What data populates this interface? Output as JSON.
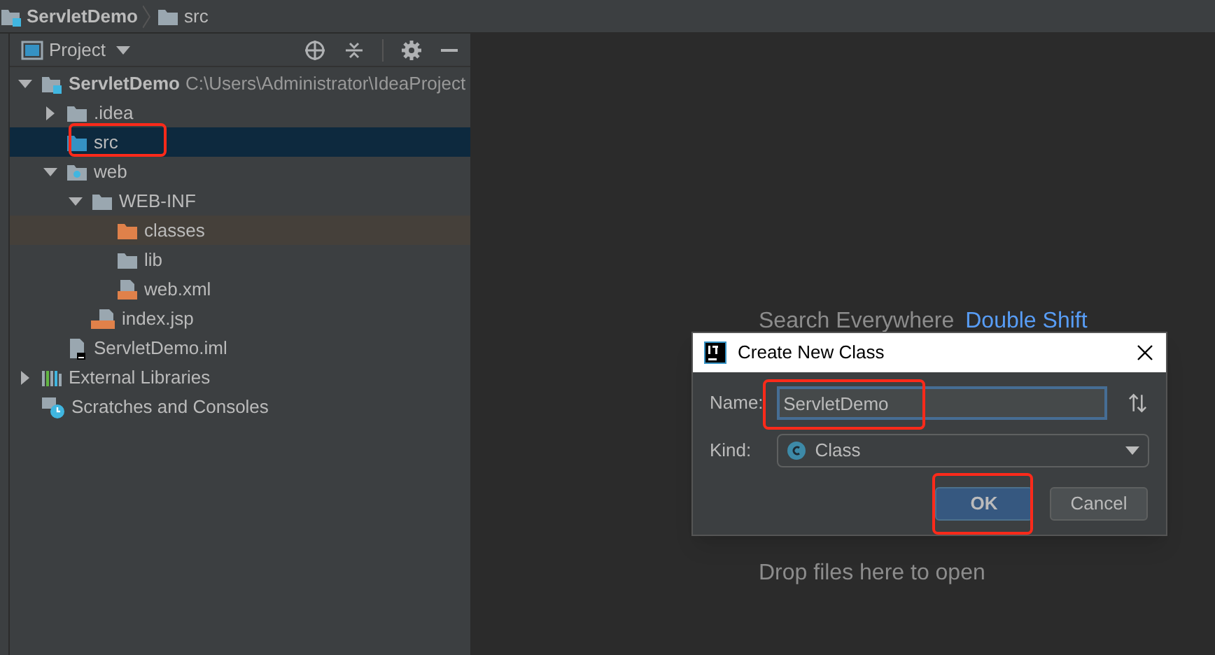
{
  "breadcrumbs": [
    {
      "label": "ServletDemo",
      "kind": "module"
    },
    {
      "label": "src",
      "kind": "folder"
    }
  ],
  "project_panel": {
    "title": "Project",
    "tree": [
      {
        "label": "ServletDemo",
        "hint": "C:\\Users\\Administrator\\IdeaProject",
        "kind": "module",
        "expanded": true,
        "selected": false,
        "highlighted": false,
        "children": [
          {
            "label": ".idea",
            "kind": "folder",
            "expanded": false,
            "selected": false,
            "highlighted": false
          },
          {
            "label": "src",
            "kind": "source",
            "selected": true,
            "highlighted": true
          },
          {
            "label": "web",
            "kind": "web",
            "expanded": true,
            "selected": false,
            "highlighted": false,
            "children": [
              {
                "label": "WEB-INF",
                "kind": "folder",
                "expanded": true,
                "selected": false,
                "highlighted": false,
                "children": [
                  {
                    "label": "classes",
                    "kind": "excluded",
                    "selected": false,
                    "hovered": true,
                    "highlighted": false
                  },
                  {
                    "label": "lib",
                    "kind": "folder",
                    "selected": false,
                    "highlighted": false
                  },
                  {
                    "label": "web.xml",
                    "kind": "xml",
                    "selected": false,
                    "highlighted": false
                  }
                ]
              },
              {
                "label": "index.jsp",
                "kind": "jsp",
                "selected": false,
                "highlighted": false
              }
            ]
          },
          {
            "label": "ServletDemo.iml",
            "kind": "iml",
            "selected": false,
            "highlighted": false
          }
        ]
      },
      {
        "label": "External Libraries",
        "kind": "libraries",
        "expanded": false,
        "selected": false,
        "highlighted": false
      },
      {
        "label": "Scratches and Consoles",
        "kind": "scratches",
        "selected": false,
        "highlighted": false
      }
    ]
  },
  "editor_hints": [
    {
      "text": "Search Everywhere",
      "shortcut": "Double Shift"
    },
    {
      "text": "Drop files here to open"
    }
  ],
  "dialog": {
    "title": "Create New Class",
    "name_field": {
      "label": "Name:",
      "value": "ServletDemo",
      "highlighted": true
    },
    "kind_field": {
      "label": "Kind:",
      "value": "Class"
    },
    "buttons": [
      {
        "label": "OK",
        "kind": "primary",
        "highlighted": true
      },
      {
        "label": "Cancel",
        "kind": "secondary",
        "highlighted": false
      }
    ]
  }
}
